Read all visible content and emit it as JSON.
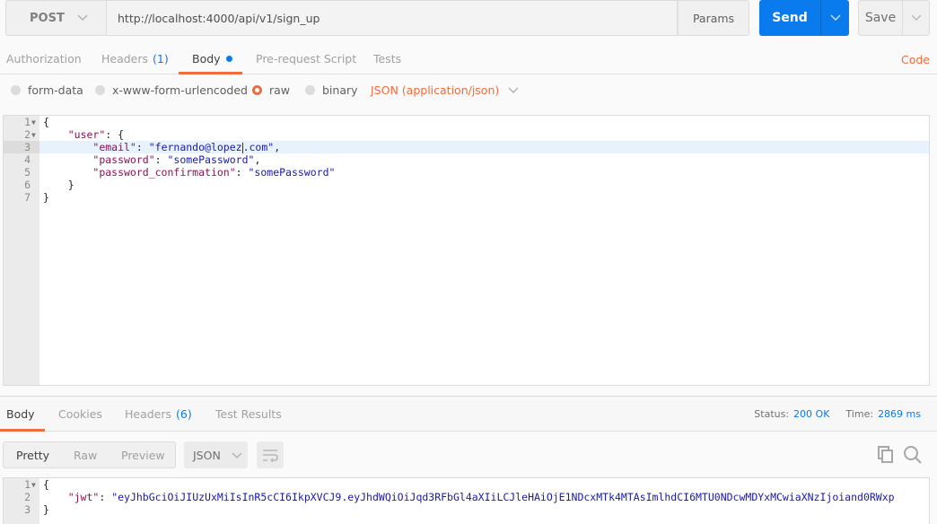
{
  "request": {
    "method": "POST",
    "url": "http://localhost:4000/api/v1/sign_up",
    "params_label": "Params",
    "send_label": "Send",
    "save_label": "Save"
  },
  "request_tabs": [
    {
      "label": "Authorization"
    },
    {
      "label": "Headers",
      "count": "(1)"
    },
    {
      "label": "Body",
      "active": true,
      "modified_dot": true
    },
    {
      "label": "Pre-request Script"
    },
    {
      "label": "Tests"
    }
  ],
  "code_link": "Code",
  "body_types": [
    {
      "label": "form-data",
      "selected": false
    },
    {
      "label": "x-www-form-urlencoded",
      "selected": false
    },
    {
      "label": "raw",
      "selected": true
    },
    {
      "label": "binary",
      "selected": false
    }
  ],
  "content_type": "JSON (application/json)",
  "request_body": {
    "line_numbers": [
      "1",
      "2",
      "3",
      "4",
      "5",
      "6",
      "7"
    ],
    "open_brace": "{",
    "user_key": "\"user\"",
    "email_key": "\"email\"",
    "email_value": "\"fernando@lopez",
    "email_value_rest": ".com\"",
    "password_key": "\"password\"",
    "password_value": "\"somePassword\"",
    "password_confirmation_key": "\"password_confirmation\"",
    "password_confirmation_value": "\"somePassword\"",
    "close_inner": "}",
    "close_outer": "}"
  },
  "response_tabs": [
    {
      "label": "Body",
      "active": true
    },
    {
      "label": "Cookies"
    },
    {
      "label": "Headers",
      "count": "(6)"
    },
    {
      "label": "Test Results"
    }
  ],
  "response_status": {
    "status_label": "Status:",
    "status_value": "200 OK",
    "time_label": "Time:",
    "time_value": "2869 ms"
  },
  "view_modes": [
    {
      "label": "Pretty",
      "active": true
    },
    {
      "label": "Raw"
    },
    {
      "label": "Preview"
    }
  ],
  "response_format": "JSON",
  "response_body": {
    "line_numbers": [
      "1",
      "2",
      "3"
    ],
    "open_brace": "{",
    "jwt_key": "\"jwt\"",
    "jwt_value": "\"eyJhbGciOiJIUzUxMiIsInR5cCI6IkpXVCJ9.eyJhdWQiOiJqd3RFbGl4aXIiLCJleHAiOjE1NDcxMTk4MTAsImlhdCI6MTU0NDcwMDYxMCwiaXNzIjoiand0RWxp",
    "close_brace": "}"
  }
}
